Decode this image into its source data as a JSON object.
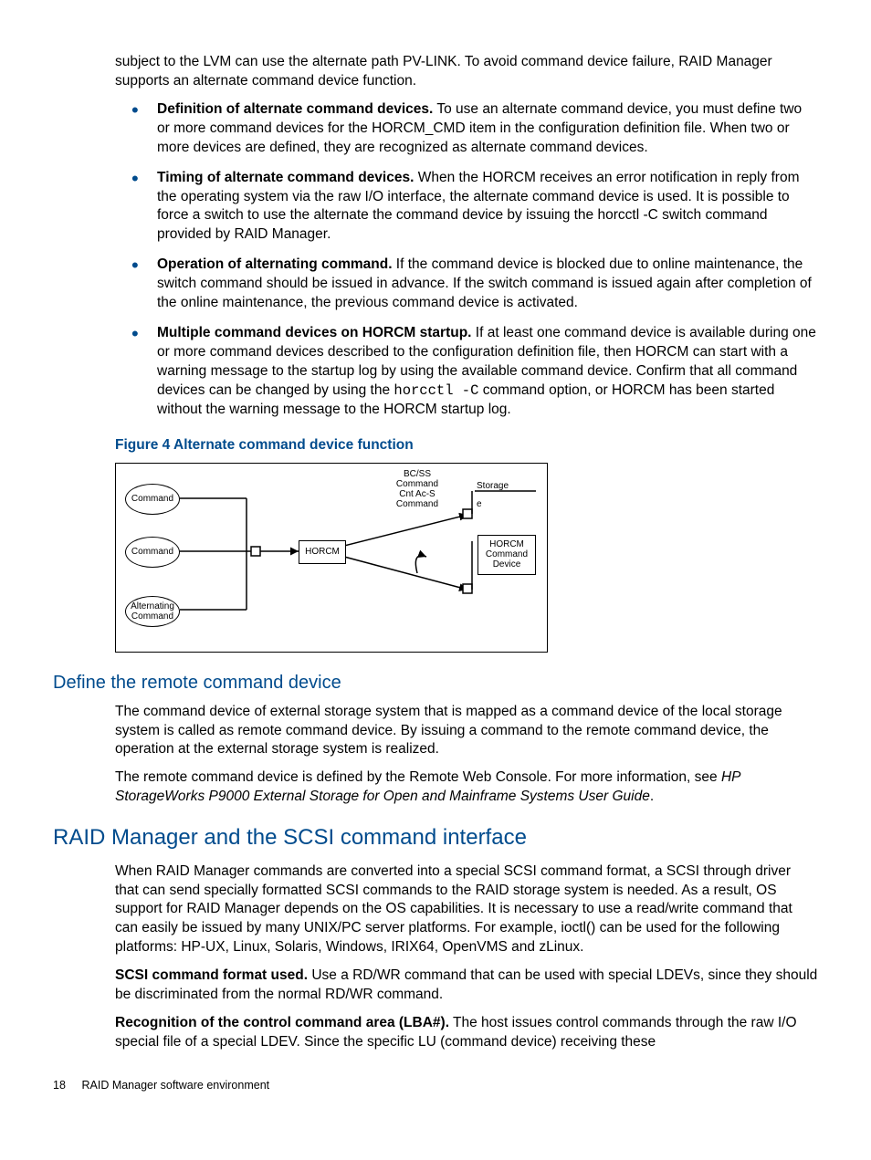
{
  "intro": "subject to the LVM can use the alternate path PV-LINK. To avoid command device failure, RAID Manager supports an alternate command device function.",
  "bullets": [
    {
      "title": "Definition of alternate command devices.",
      "body": " To use an alternate command device, you must define two or more command devices for the HORCM_CMD item in the configuration definition file. When two or more devices are defined, they are recognized as alternate command devices."
    },
    {
      "title": "Timing of alternate command devices.",
      "body": " When the HORCM receives an error notification in reply from the operating system via the raw I/O interface, the alternate command device is used. It is possible to force a switch to use the alternate the command device by issuing the horcctl -C switch command provided by RAID Manager."
    },
    {
      "title": "Operation of alternating command.",
      "body": " If the command device is blocked due to online maintenance, the switch command should be issued in advance. If the switch command is issued again after completion of the online maintenance, the previous command device is activated."
    },
    {
      "title": "Multiple command devices on HORCM startup.",
      "body_pre": " If at least one command device is available during one or more command devices described to the configuration definition file, then HORCM can start with a warning message to the startup log by using the available command device. Confirm that all command devices can be changed by using the ",
      "code": "horcctl -C",
      "body_post": " command option, or HORCM has been started without the warning message to the HORCM startup log."
    }
  ],
  "figure_title": "Figure 4 Alternate command device function",
  "diagram": {
    "ov1": "Command",
    "ov2": "Command",
    "ov3": "Alternating\nCommand",
    "horcm": "HORCM",
    "topcmd": "BC/SS\nCommand\nCnt Ac-S\nCommand",
    "storage": "Storage",
    "e": "e",
    "right": "HORCM\nCommand\nDevice"
  },
  "h2": "Define the remote command device",
  "p_remote1": "The command device of external storage system that is mapped as a command device of the local storage system is called as remote command device. By issuing a command to the remote command device, the operation at the external storage system is realized.",
  "p_remote2a": "The remote command device is defined by the Remote Web Console. For more information, see ",
  "p_remote2b": "HP StorageWorks P9000 External Storage for Open and Mainframe Systems User Guide",
  "p_remote2c": ".",
  "h1": "RAID Manager and the SCSI command interface",
  "p_scsi1": "When RAID Manager commands are converted into a special SCSI command format, a SCSI through driver that can send specially formatted SCSI commands to the RAID storage system is needed. As a result, OS support for RAID Manager depends on the OS capabilities. It is necessary to use a read/write command that can easily be issued by many UNIX/PC server platforms. For example, ioctl() can be used for the following platforms: HP-UX, Linux, Solaris, Windows, IRIX64, OpenVMS and zLinux.",
  "p_scsi2t": "SCSI command format used.",
  "p_scsi2b": " Use a RD/WR command that can be used with special LDEVs, since they should be discriminated from the normal RD/WR command.",
  "p_scsi3t": "Recognition of the control command area (LBA#).",
  "p_scsi3b": " The host issues control commands through the raw I/O special file of a special LDEV. Since the specific LU (command device) receiving these",
  "footer_page": "18",
  "footer_text": "RAID Manager software environment"
}
